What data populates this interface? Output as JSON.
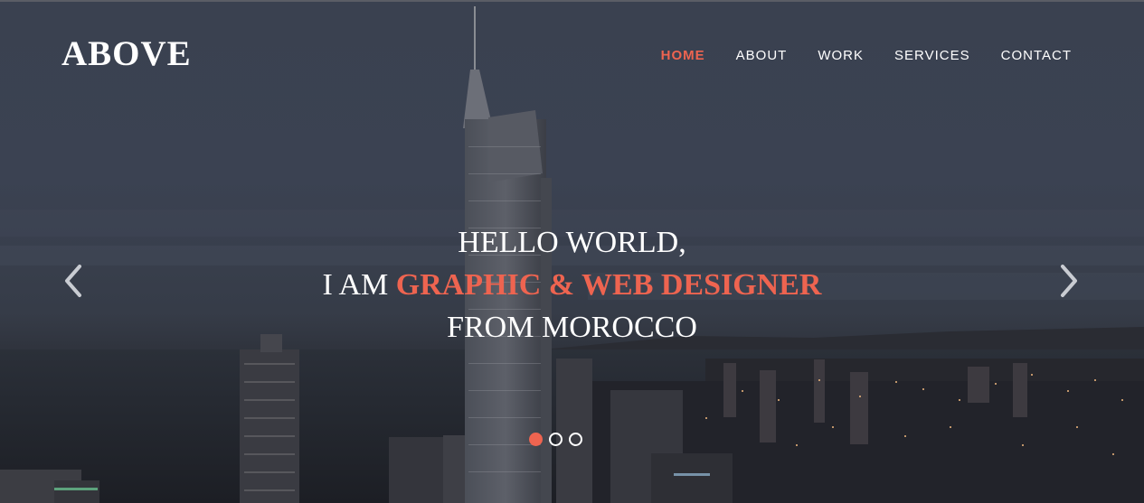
{
  "brand": {
    "logo_text": "ABOVE"
  },
  "nav": {
    "items": [
      {
        "label": "HOME",
        "active": true
      },
      {
        "label": "ABOUT",
        "active": false
      },
      {
        "label": "WORK",
        "active": false
      },
      {
        "label": "SERVICES",
        "active": false
      },
      {
        "label": "CONTACT",
        "active": false
      }
    ]
  },
  "hero": {
    "line1": "HELLO WORLD,",
    "line2_prefix": "I AM ",
    "line2_highlight": "GRAPHIC & WEB DESIGNER",
    "line3": "FROM MOROCCO"
  },
  "slider": {
    "prev_icon": "chevron-left-icon",
    "next_icon": "chevron-right-icon",
    "dots": [
      {
        "active": true
      },
      {
        "active": false
      },
      {
        "active": false
      }
    ]
  },
  "colors": {
    "accent": "#ee6450",
    "text": "#ffffff",
    "sky": "#3b4252"
  }
}
